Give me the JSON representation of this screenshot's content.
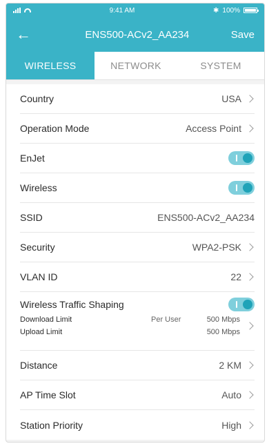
{
  "status_bar": {
    "time": "9:41 AM",
    "bluetooth": "✱",
    "battery": "100%"
  },
  "nav": {
    "back_icon": "←",
    "title": "ENS500-ACv2_AA234",
    "save": "Save"
  },
  "tabs": [
    {
      "label": "WIRELESS",
      "active": true
    },
    {
      "label": "NETWORK",
      "active": false
    },
    {
      "label": "SYSTEM",
      "active": false
    }
  ],
  "settings": {
    "country": {
      "label": "Country",
      "value": "USA"
    },
    "operation_mode": {
      "label": "Operation Mode",
      "value": "Access Point"
    },
    "enjet": {
      "label": "EnJet",
      "on": true
    },
    "wireless": {
      "label": "Wireless",
      "on": true
    },
    "ssid": {
      "label": "SSID",
      "value": "ENS500-ACv2_AA234"
    },
    "security": {
      "label": "Security",
      "value": "WPA2-PSK"
    },
    "vlan_id": {
      "label": "VLAN ID",
      "value": "22"
    },
    "traffic_shaping": {
      "label": "Wireless Traffic Shaping",
      "on": true,
      "download_label": "Download Limit",
      "upload_label": "Upload Limit",
      "mode": "Per User",
      "download_value": "500 Mbps",
      "upload_value": "500 Mbps"
    },
    "distance": {
      "label": "Distance",
      "value": "2 KM"
    },
    "ap_time_slot": {
      "label": "AP Time Slot",
      "value": "Auto"
    },
    "station_priority": {
      "label": "Station Priority",
      "value": "High"
    }
  },
  "colors": {
    "accent": "#3ab3c7",
    "toggle_track": "#7fcfdc",
    "toggle_knob": "#1fa3b8"
  }
}
